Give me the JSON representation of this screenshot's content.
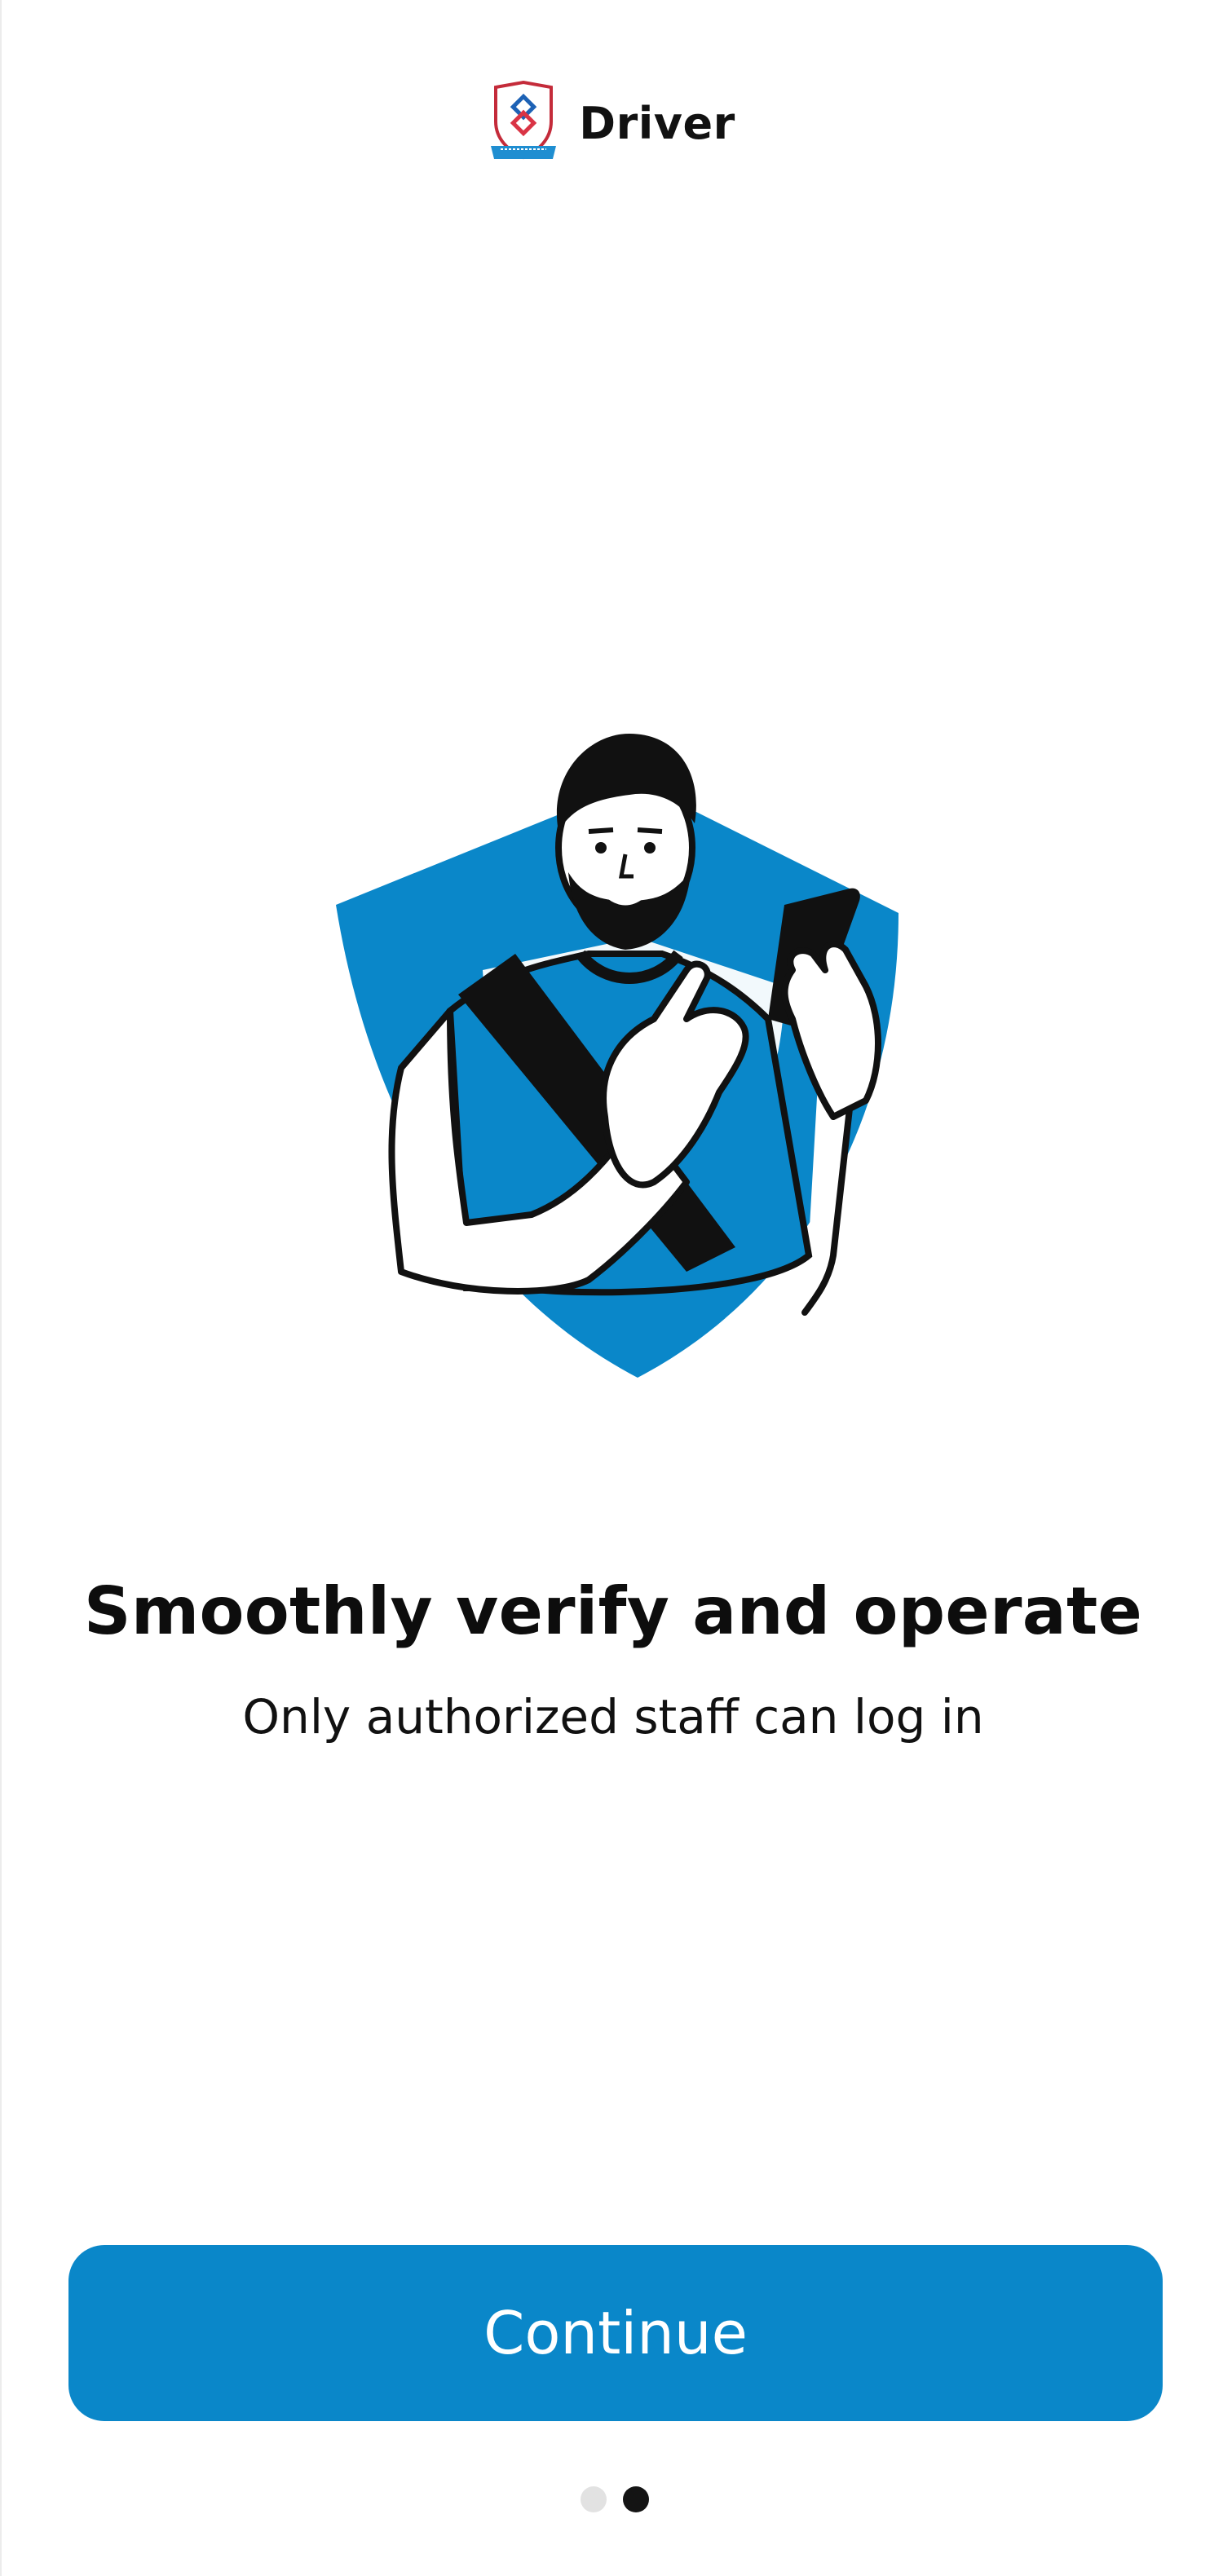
{
  "header": {
    "app_name": "Driver",
    "logo_icon": "shield-crest-logo"
  },
  "hero": {
    "illustration": "driver-holding-phone-illustration"
  },
  "content": {
    "title": "Smoothly verify and operate",
    "subtitle": "Only authorized staff can log in"
  },
  "actions": {
    "continue_label": "Continue"
  },
  "pagination": {
    "total_pages": 2,
    "current_page": 2
  },
  "colors": {
    "accent": "#0a87c9",
    "text": "#111111",
    "dot_inactive": "#e2e2e2",
    "dot_active": "#141414"
  }
}
